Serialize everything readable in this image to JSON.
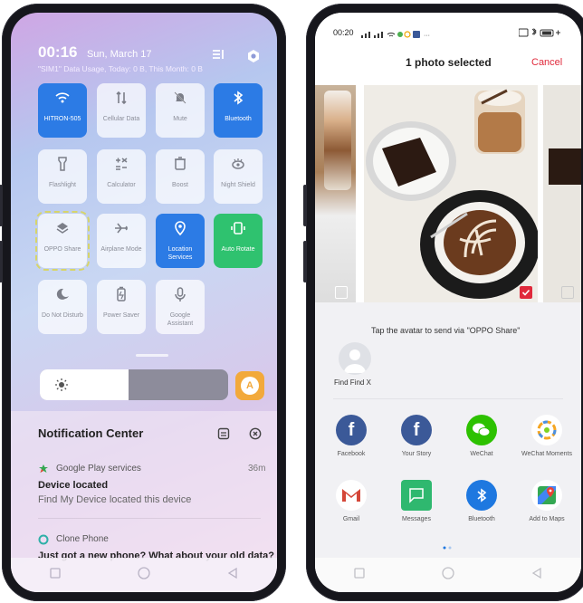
{
  "left_phone": {
    "time": "00:16",
    "date": "Sun, March 17",
    "data_usage": "\"SIM1\" Data Usage, Today: 0 B, This Month: 0 B",
    "tiles": [
      {
        "label": "HITRON-505",
        "icon": "wifi-icon",
        "state": "on"
      },
      {
        "label": "Cellular Data",
        "icon": "cellular-data-icon",
        "state": "off"
      },
      {
        "label": "Mute",
        "icon": "mute-bell-icon",
        "state": "off"
      },
      {
        "label": "Bluetooth",
        "icon": "bluetooth-icon",
        "state": "on"
      },
      {
        "label": "Flashlight",
        "icon": "flashlight-icon",
        "state": "off"
      },
      {
        "label": "Calculator",
        "icon": "calculator-icon",
        "state": "off"
      },
      {
        "label": "Boost",
        "icon": "boost-icon",
        "state": "off"
      },
      {
        "label": "Night Shield",
        "icon": "night-shield-icon",
        "state": "off"
      },
      {
        "label": "OPPO Share",
        "icon": "oppo-share-icon",
        "state": "off"
      },
      {
        "label": "Airplane Mode",
        "icon": "airplane-icon",
        "state": "off"
      },
      {
        "label": "Location Services",
        "icon": "location-icon",
        "state": "on"
      },
      {
        "label": "Auto Rotate",
        "icon": "auto-rotate-icon",
        "state": "on"
      },
      {
        "label": "Do Not Disturb",
        "icon": "moon-icon",
        "state": "off"
      },
      {
        "label": "Power Saver",
        "icon": "battery-icon",
        "state": "off"
      },
      {
        "label": "Google Assistant",
        "icon": "microphone-icon",
        "state": "off"
      }
    ],
    "brightness_level": 0.47,
    "auto_brightness_letter": "A",
    "notification_center": {
      "title": "Notification Center",
      "items": [
        {
          "app": "Google Play services",
          "time": "36m",
          "title": "Device located",
          "text": "Find My Device located this device"
        },
        {
          "app": "Clone Phone",
          "time": "",
          "title": "Just got a new phone? What about your old data?",
          "text": ""
        }
      ]
    }
  },
  "right_phone": {
    "time": "00:20",
    "title": "1 photo selected",
    "cancel": "Cancel",
    "oppo_share_hint": "Tap the avatar to send via \"OPPO Share\"",
    "nearby_device": "Find Find X",
    "apps": [
      {
        "label": "Facebook",
        "icon": "facebook-icon",
        "color": "#3b5998"
      },
      {
        "label": "Your Story",
        "icon": "facebook-icon",
        "color": "#3b5998"
      },
      {
        "label": "WeChat",
        "icon": "wechat-icon",
        "color": "#2dc100"
      },
      {
        "label": "WeChat Moments",
        "icon": "wechat-moments-icon",
        "color": "#ffffff"
      },
      {
        "label": "Gmail",
        "icon": "gmail-icon",
        "color": "#ffffff"
      },
      {
        "label": "Messages",
        "icon": "messages-icon",
        "color": "#2fb86f"
      },
      {
        "label": "Bluetooth",
        "icon": "bluetooth-icon",
        "color": "#1e78e0"
      },
      {
        "label": "Add to Maps",
        "icon": "maps-icon",
        "color": "#ffffff"
      }
    ]
  },
  "colors": {
    "accent_blue": "#2c7be5",
    "accent_green": "#2fc26f",
    "cancel_red": "#e0293b",
    "auto_brightness": "#f2a93b"
  }
}
